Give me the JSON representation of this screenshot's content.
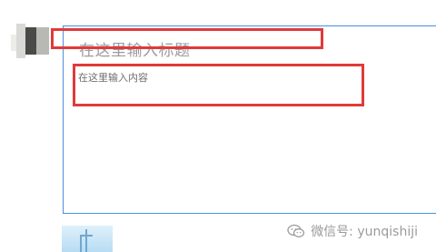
{
  "editor": {
    "title_placeholder": "在这里输入标题",
    "content_placeholder": "在这里输入内容"
  },
  "watermark": {
    "icon": "wechat-icon",
    "text": "微信号: yunqishiji"
  },
  "colors": {
    "annotation": "#e03a3a",
    "editor_border": "#4a90d9"
  }
}
